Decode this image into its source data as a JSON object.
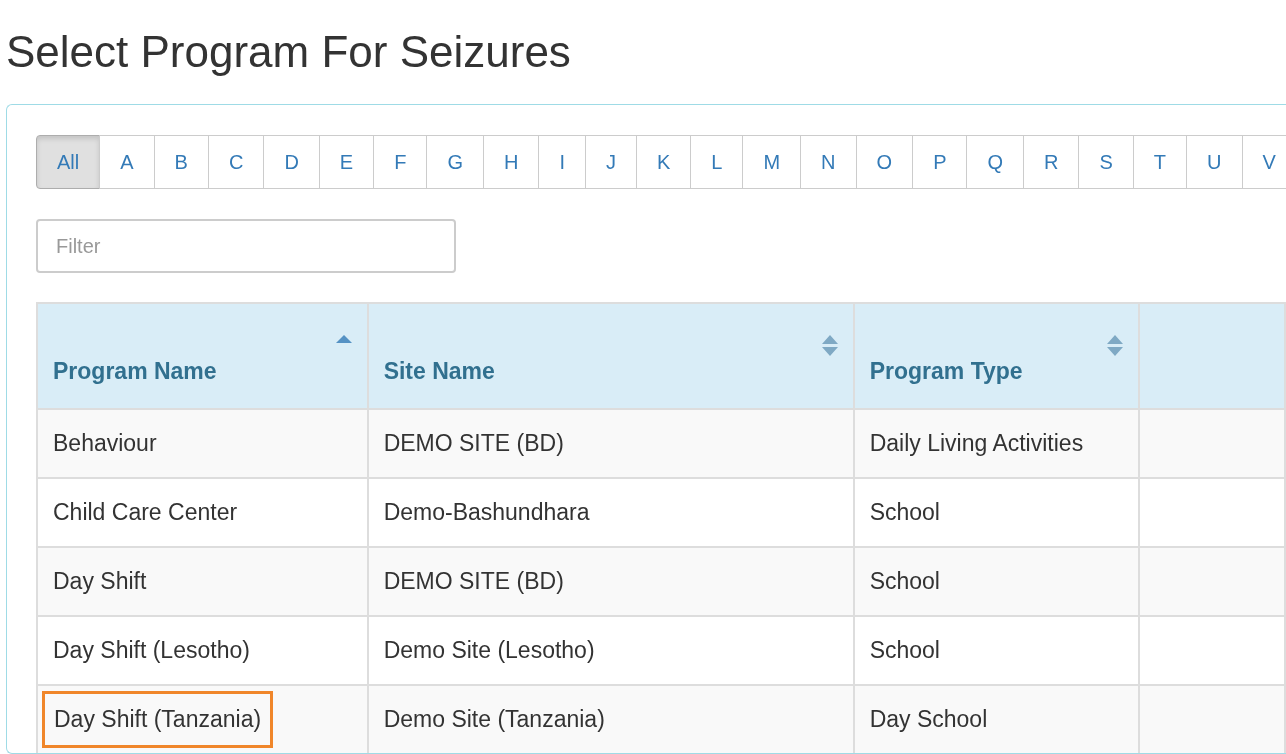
{
  "title": "Select Program For Seizures",
  "letters": [
    {
      "label": "All",
      "selected": true
    },
    {
      "label": "A",
      "selected": false
    },
    {
      "label": "B",
      "selected": false
    },
    {
      "label": "C",
      "selected": false
    },
    {
      "label": "D",
      "selected": false
    },
    {
      "label": "E",
      "selected": false
    },
    {
      "label": "F",
      "selected": false
    },
    {
      "label": "G",
      "selected": false
    },
    {
      "label": "H",
      "selected": false
    },
    {
      "label": "I",
      "selected": false
    },
    {
      "label": "J",
      "selected": false
    },
    {
      "label": "K",
      "selected": false
    },
    {
      "label": "L",
      "selected": false
    },
    {
      "label": "M",
      "selected": false
    },
    {
      "label": "N",
      "selected": false
    },
    {
      "label": "O",
      "selected": false
    },
    {
      "label": "P",
      "selected": false
    },
    {
      "label": "Q",
      "selected": false
    },
    {
      "label": "R",
      "selected": false
    },
    {
      "label": "S",
      "selected": false
    },
    {
      "label": "T",
      "selected": false
    },
    {
      "label": "U",
      "selected": false
    },
    {
      "label": "V",
      "selected": false
    }
  ],
  "filter": {
    "placeholder": "Filter"
  },
  "table": {
    "columns": [
      {
        "label": "Program Name",
        "sorted_ascending": true
      },
      {
        "label": "Site Name",
        "sorted_ascending": false
      },
      {
        "label": "Program Type",
        "sorted_ascending": false
      }
    ],
    "rows": [
      {
        "cells": [
          "Behaviour",
          "DEMO SITE (BD)",
          "Daily Living Activities"
        ],
        "highlighted": false
      },
      {
        "cells": [
          "Child Care Center",
          "Demo-Bashundhara",
          "School"
        ],
        "highlighted": false
      },
      {
        "cells": [
          "Day Shift",
          "DEMO SITE (BD)",
          "School"
        ],
        "highlighted": false
      },
      {
        "cells": [
          "Day Shift (Lesotho)",
          "Demo Site (Lesotho)",
          "School"
        ],
        "highlighted": false
      },
      {
        "cells": [
          "Day Shift (Tanzania)",
          "Demo Site (Tanzania)",
          "Day School"
        ],
        "highlighted": true
      }
    ]
  }
}
